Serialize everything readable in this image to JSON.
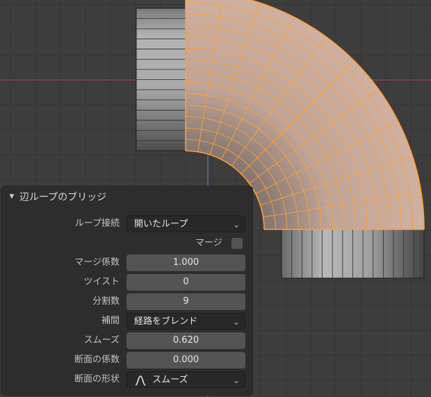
{
  "panel": {
    "title": "辺ループのブリッジ",
    "loop_connect": {
      "label": "ループ接続",
      "value": "開いたループ"
    },
    "merge": {
      "label": "マージ",
      "checked": false
    },
    "merge_factor": {
      "label": "マージ係数",
      "value": "1.000"
    },
    "twist": {
      "label": "ツイスト",
      "value": "0"
    },
    "cuts": {
      "label": "分割数",
      "value": "9"
    },
    "interpolation": {
      "label": "補間",
      "value": "経路をブレンド"
    },
    "smoothness": {
      "label": "スムーズ",
      "value": "0.620"
    },
    "profile_factor": {
      "label": "断面の係数",
      "value": "0.000"
    },
    "profile_shape": {
      "label": "断面の形状",
      "value": "スムーズ",
      "icon": "smooth-curve-icon"
    }
  },
  "colors": {
    "background": "#3d3d3d",
    "selection": "#ffa033",
    "x_axis": "#b8434f",
    "y_axis": "#5e86c4"
  }
}
